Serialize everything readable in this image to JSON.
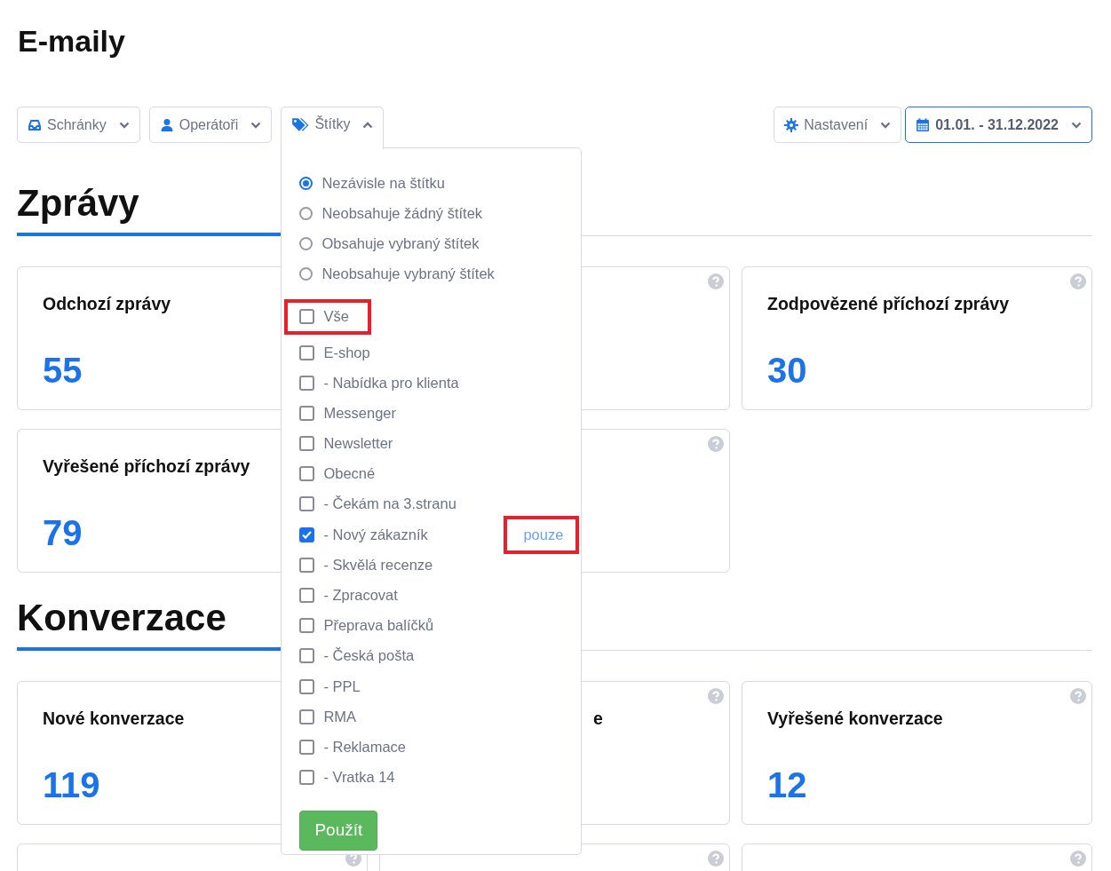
{
  "page_title": "E-maily",
  "toolbar": {
    "left": [
      {
        "label": "Schránky",
        "open": false,
        "active": false
      },
      {
        "label": "Operátoři",
        "open": false,
        "active": false
      },
      {
        "label": "Štítky",
        "open": true,
        "active": false
      }
    ],
    "right": [
      {
        "label": "Nastavení",
        "open": false,
        "active": false
      },
      {
        "label": "01.01. - 31.12.2022",
        "open": false,
        "active": true
      }
    ]
  },
  "tag_menu": {
    "modes": [
      {
        "label": "Nezávisle na štítku",
        "selected": true
      },
      {
        "label": "Neobsahuje žádný štítek",
        "selected": false
      },
      {
        "label": "Obsahuje vybraný štítek",
        "selected": false
      },
      {
        "label": "Neobsahuje vybraný štítek",
        "selected": false
      }
    ],
    "tags": [
      {
        "label": "Vše",
        "checked": false,
        "highlighted": true
      },
      {
        "label": "E-shop",
        "checked": false,
        "highlighted": false
      },
      {
        "label": "- Nabídka pro klienta",
        "checked": false,
        "highlighted": false
      },
      {
        "label": "Messenger",
        "checked": false,
        "highlighted": false
      },
      {
        "label": "Newsletter",
        "checked": false,
        "highlighted": false
      },
      {
        "label": "Obecné",
        "checked": false,
        "highlighted": false
      },
      {
        "label": "- Čekám na 3.stranu",
        "checked": false,
        "highlighted": false
      },
      {
        "label": "- Nový zákazník",
        "checked": true,
        "highlighted": false,
        "action": "pouze",
        "action_highlighted": true
      },
      {
        "label": "- Skvělá recenze",
        "checked": false,
        "highlighted": false
      },
      {
        "label": "- Zpracovat",
        "checked": false,
        "highlighted": false
      },
      {
        "label": "Přeprava balíčků",
        "checked": false,
        "highlighted": false
      },
      {
        "label": "- Česká pošta",
        "checked": false,
        "highlighted": false
      },
      {
        "label": "- PPL",
        "checked": false,
        "highlighted": false
      },
      {
        "label": "RMA",
        "checked": false,
        "highlighted": false
      },
      {
        "label": "- Reklamace",
        "checked": false,
        "highlighted": false
      },
      {
        "label": "- Vratka 14",
        "checked": false,
        "highlighted": false
      }
    ],
    "apply": "Použít"
  },
  "sections": [
    {
      "title": "Zprávy",
      "cards": [
        {
          "title": "Odchozí zprávy",
          "value": "55",
          "help": false
        },
        {
          "help": true
        },
        {
          "title": "Zodpovězené příchozí zprávy",
          "value": "30",
          "help": true
        },
        {
          "title": "Vyřešené příchozí zprávy",
          "value": "79",
          "help": false
        },
        {
          "help": true
        }
      ]
    },
    {
      "title": "Konverzace",
      "cards": [
        {
          "title": "Nové konverzace",
          "value": "119",
          "help": false
        },
        {
          "title_tail": "e",
          "help": true
        },
        {
          "title": "Vyřešené konverzace",
          "value": "12",
          "help": true
        },
        {
          "help": true
        },
        {
          "help": true
        },
        {
          "help": true
        }
      ]
    }
  ]
}
